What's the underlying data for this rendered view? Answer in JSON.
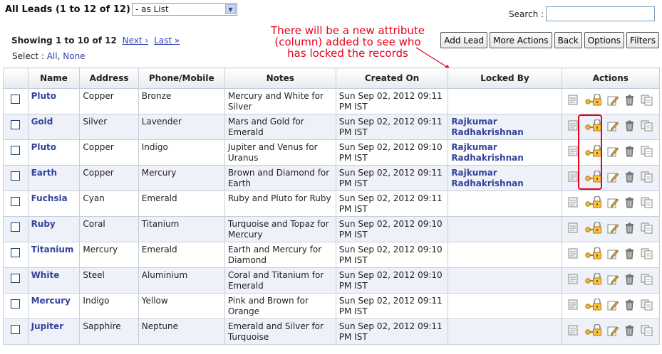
{
  "header": {
    "title": "All Leads (1 to 12 of 12)",
    "view_select_value": "- as List",
    "search_label": "Search :"
  },
  "pagination": {
    "showing_label": "Showing 1 to 10 of 12",
    "next_label": "Next ›",
    "last_label": "Last »"
  },
  "select": {
    "label": "Select :",
    "all_label": "All",
    "none_label": "None"
  },
  "annotation": {
    "lines": [
      "There will be a new attribute",
      "(column) added to see who",
      "has locked the records"
    ]
  },
  "toolbar": {
    "add_lead": "Add Lead",
    "more_actions": "More Actions",
    "back": "Back",
    "options": "Options",
    "filters": "Filters"
  },
  "table": {
    "headers": [
      "Name",
      "Address",
      "Phone/Mobile",
      "Notes",
      "Created On",
      "Locked By",
      "Actions"
    ],
    "rows": [
      {
        "name": "Pluto",
        "address": "Copper",
        "phone": "Bronze",
        "notes": "Mercury and White for Silver",
        "created": "Sun Sep 02, 2012 09:11 PM IST",
        "locked": ""
      },
      {
        "name": "Gold",
        "address": "Silver",
        "phone": "Lavender",
        "notes": "Mars and Gold for Emerald",
        "created": "Sun Sep 02, 2012 09:11 PM IST",
        "locked": "Rajkumar Radhakrishnan"
      },
      {
        "name": "Pluto",
        "address": "Copper",
        "phone": "Indigo",
        "notes": "Jupiter and Venus for Uranus",
        "created": "Sun Sep 02, 2012 09:10 PM IST",
        "locked": "Rajkumar Radhakrishnan"
      },
      {
        "name": "Earth",
        "address": "Copper",
        "phone": "Mercury",
        "notes": "Brown and Diamond for Earth",
        "created": "Sun Sep 02, 2012 09:11 PM IST",
        "locked": "Rajkumar Radhakrishnan"
      },
      {
        "name": "Fuchsia",
        "address": "Cyan",
        "phone": "Emerald",
        "notes": "Ruby and Pluto for Ruby",
        "created": "Sun Sep 02, 2012 09:11 PM IST",
        "locked": ""
      },
      {
        "name": "Ruby",
        "address": "Coral",
        "phone": "Titanium",
        "notes": "Turquoise and Topaz for Mercury",
        "created": "Sun Sep 02, 2012 09:10 PM IST",
        "locked": ""
      },
      {
        "name": "Titanium",
        "address": "Mercury",
        "phone": "Emerald",
        "notes": "Earth and Mercury for Diamond",
        "created": "Sun Sep 02, 2012 09:10 PM IST",
        "locked": ""
      },
      {
        "name": "White",
        "address": "Steel",
        "phone": "Aluminium",
        "notes": "Coral and Titanium for Emerald",
        "created": "Sun Sep 02, 2012 09:10 PM IST",
        "locked": ""
      },
      {
        "name": "Mercury",
        "address": "Indigo",
        "phone": "Yellow",
        "notes": "Pink and Brown for Orange",
        "created": "Sun Sep 02, 2012 09:11 PM IST",
        "locked": ""
      },
      {
        "name": "Jupiter",
        "address": "Sapphire",
        "phone": "Neptune",
        "notes": "Emerald and Silver for Turquoise",
        "created": "Sun Sep 02, 2012 09:11 PM IST",
        "locked": ""
      }
    ]
  },
  "icons": [
    "view-icon",
    "lock-icon",
    "edit-icon",
    "delete-icon",
    "copy-icon"
  ],
  "colors": {
    "link": "#3344aa",
    "annotation": "#e8001c",
    "row_alt": "#eef1f8"
  }
}
